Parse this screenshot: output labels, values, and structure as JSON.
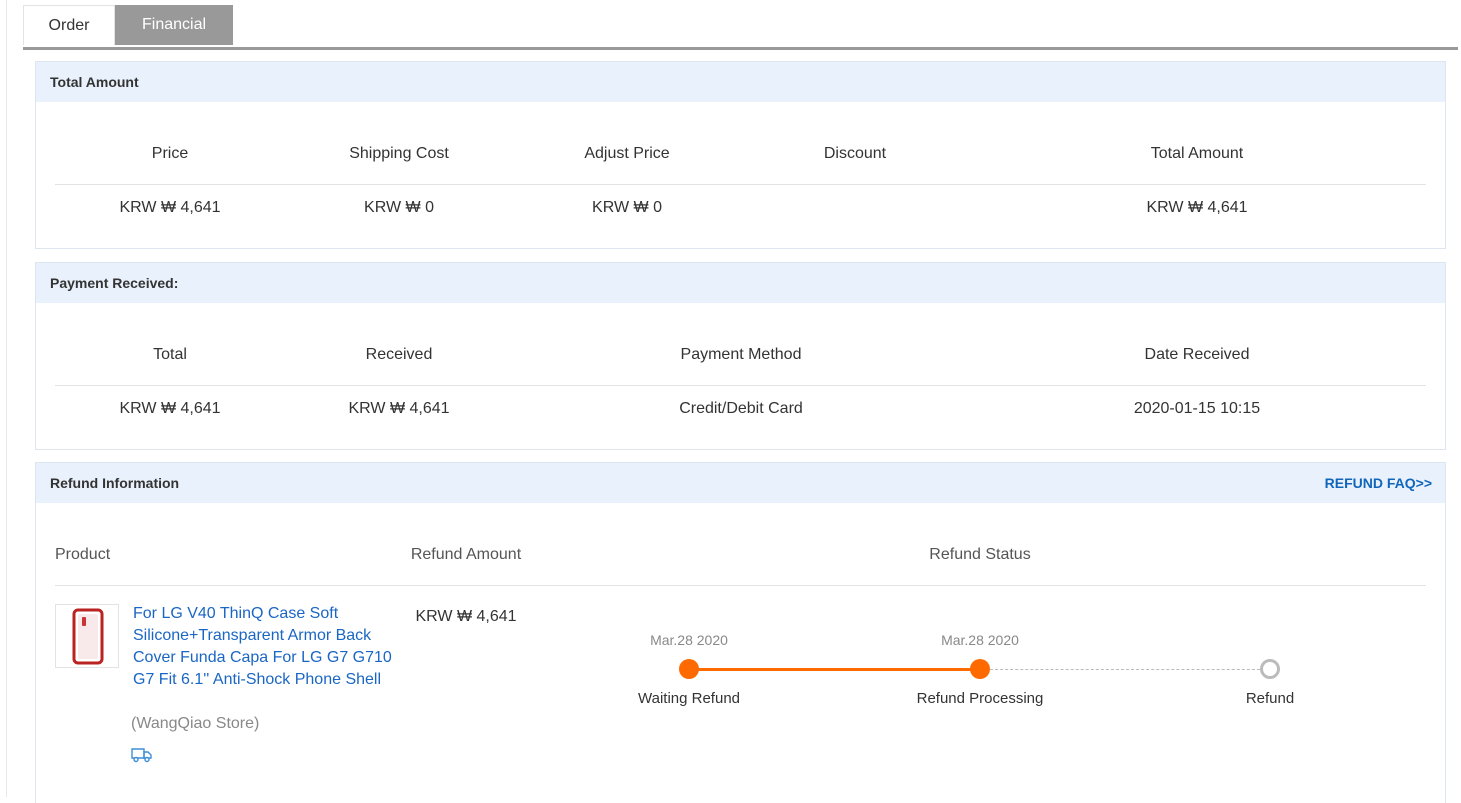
{
  "tabs": {
    "order": "Order",
    "financial": "Financial"
  },
  "total_amount": {
    "title": "Total Amount",
    "headers": [
      "Price",
      "Shipping Cost",
      "Adjust Price",
      "Discount",
      "Total Amount"
    ],
    "values": [
      "KRW ₩ 4,641",
      "KRW ₩ 0",
      "KRW ₩ 0",
      "",
      "KRW ₩ 4,641"
    ]
  },
  "payment": {
    "title": "Payment Received:",
    "headers": [
      "Total",
      "Received",
      "Payment Method",
      "Date Received"
    ],
    "values": [
      "KRW ₩ 4,641",
      "KRW ₩ 4,641",
      "Credit/Debit Card",
      "2020-01-15 10:15"
    ]
  },
  "refund": {
    "title": "Refund Information",
    "faq": "REFUND FAQ>>",
    "headers": {
      "product": "Product",
      "amount": "Refund Amount",
      "status": "Refund Status"
    },
    "product_name": "For LG V40 ThinQ Case Soft Silicone+Transparent Armor Back Cover Funda Capa For LG G7 G710 G7 Fit 6.1'' Anti-Shock Phone Shell",
    "store": "(WangQiao Store)",
    "amount": "KRW ₩ 4,641",
    "steps": [
      {
        "label": "Waiting Refund",
        "date": "Mar.28 2020",
        "done": true
      },
      {
        "label": "Refund Processing",
        "date": "Mar.28 2020",
        "done": true
      },
      {
        "label": "Refund",
        "date": "",
        "done": false
      }
    ],
    "progress_color": "#ff6a00",
    "link_color": "#1a66c4"
  }
}
